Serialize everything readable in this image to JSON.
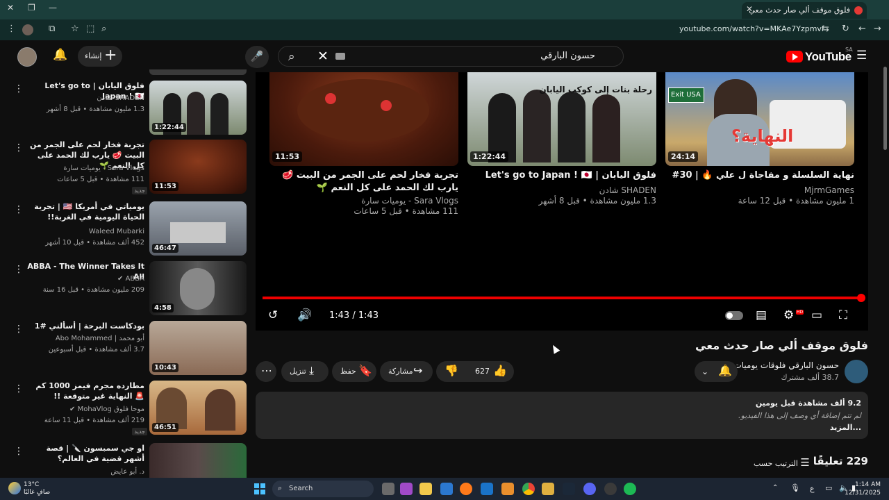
{
  "browser": {
    "tab_title": "فلوق موقف ألي صار حدث معي",
    "url": "youtube.com/watch?v=MKAe7Yzpmvl"
  },
  "header": {
    "search_query": "حسون البارقي",
    "create_label": "إنشاء",
    "logo_text": "YouTube",
    "country_code": "SA"
  },
  "end_cards": [
    {
      "title": "نهاية السلسلة و مفاجاة ل علي 🔥 | 30#",
      "channel": "MjrmGames",
      "meta": "1 مليون مشاهدة • قبل 12 ساعة",
      "duration": "24:14",
      "thumb_color": "#5a7fa6",
      "thumb_text": "النهاية؟",
      "sign_text": "Exit USA"
    },
    {
      "title": "فلوق اليابان | Let's go to Japan ! 🇯🇵",
      "channel": "SHADEN شادن",
      "meta": "1.3 مليون مشاهدة • قبل 8 أشهر",
      "duration": "1:22:44",
      "thumb_color": "#7d8a70",
      "thumb_text": "رحلة بنات إلى كوكب اليابان"
    },
    {
      "title": "تجربة فخار لحم على الجمر من البيت 🥩 يارب لك الحمد على كل النعم 🌱",
      "channel": "Sara Vlogs - يوميات سارة",
      "meta": "111 مشاهدة • قبل 5 ساعات",
      "duration": "11:53",
      "thumb_color": "#6b2e1a"
    }
  ],
  "player": {
    "time_display": "1:43 / 1:43",
    "progress": 1.0
  },
  "video": {
    "title": "فلوق موقف ألي صار حدث معي",
    "channel": "حسون البارقي فلوقات يوميات",
    "subscribers": "38.7 ألف مشترك",
    "likes": "627",
    "share_label": "مشاركة",
    "save_label": "حفظ",
    "download_label": "تنزيل",
    "views_line": "9.2 ألف مشاهدة  قبل يومين",
    "desc_placeholder": "لم تتم إضافة أي وصف إلى هذا الفيديو.",
    "more_label": "...المزيد",
    "comments_count": "229 تعليقًا",
    "sort_label": "الترتيب حسب"
  },
  "sidebar": [
    {
      "title": "فلوق اليابان | Let's go to Japan ! 🇯🇵",
      "channel": "SHADEN شادن",
      "meta": "1.3 مليون مشاهدة • قبل 8 أشهر",
      "duration": "1:22:44",
      "thumb_color": "#7d8a70",
      "new": ""
    },
    {
      "title": "تجربة فخار لحم على الجمر من البيت 🥩 يارب لك الحمد على كل النعم 🌱",
      "channel": "Sara Vlogs - يوميات سارة",
      "meta": "111 مشاهدة • قبل 5 ساعات",
      "duration": "11:53",
      "thumb_color": "#6b2e1a",
      "new": "جديد"
    },
    {
      "title": "يومياتي في أمريكا 🇺🇸 | تجربة الحياة اليومية في الغربة!!",
      "channel": "Waleed Mubarki",
      "meta": "452 ألف مشاهدة • قبل 10 أشهر",
      "duration": "46:47",
      "thumb_color": "#7a7f8a",
      "new": ""
    },
    {
      "title": "ABBA - The Winner Takes It All",
      "channel": "ABBA ✔",
      "meta": "209 مليون مشاهدة • قبل 16 سنة",
      "duration": "4:58",
      "thumb_color": "#3a3a3a",
      "new": ""
    },
    {
      "title": "بودكاست البرحة | أسألني #1",
      "channel": "أبو محمد | Abo Mohammed",
      "meta": "3.7 ألف مشاهدة • قبل أسبوعين",
      "duration": "10:43",
      "thumb_color": "#8a6a55",
      "new": ""
    },
    {
      "title": "مطارده مجرم فيمز 1000 كم 🚨 النهاية غير متوقعة !!",
      "channel": "موحا فلوق MohaVlog ✔",
      "meta": "219 ألف مشاهدة • قبل 11 ساعة",
      "duration": "46:51",
      "thumb_color": "#a86a3c",
      "new": "جديد"
    },
    {
      "title": "او جي سمبسون 🔪 | قصة أشهر قضية في العالم؟",
      "channel": "د. أبو عايض",
      "meta": "",
      "duration": "",
      "thumb_color": "#4a3a3a",
      "new": ""
    }
  ],
  "taskbar": {
    "search_label": "Search",
    "temperature": "13°C",
    "weather": "صافٍ غالبًا",
    "time": "1:14 AM",
    "date": "12/31/2025",
    "lang": "ع"
  },
  "colors": {
    "accent_red": "#ff0000",
    "browser_chrome": "#1b3e3b"
  }
}
